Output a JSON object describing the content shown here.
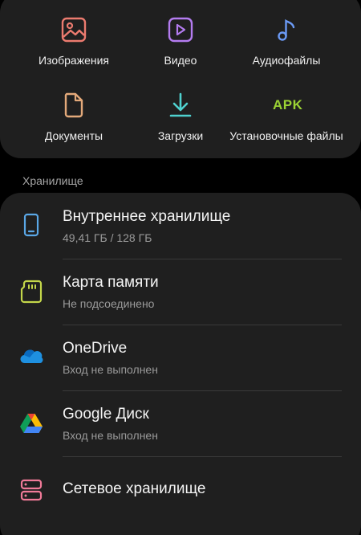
{
  "categories": [
    {
      "label": "Изображения",
      "icon": "image-icon",
      "color": "#ec7b6f"
    },
    {
      "label": "Видео",
      "icon": "video-icon",
      "color": "#b47cf0"
    },
    {
      "label": "Аудиофайлы",
      "icon": "music-note-icon",
      "color": "#6b9af5"
    },
    {
      "label": "Документы",
      "icon": "document-icon",
      "color": "#e3a97a"
    },
    {
      "label": "Загрузки",
      "icon": "download-icon",
      "color": "#4fd1cf"
    },
    {
      "label": "Установочные файлы",
      "icon": "apk-icon",
      "color": "#9bd234",
      "glyph": "APK"
    }
  ],
  "storage": {
    "section_title": "Хранилище",
    "items": [
      {
        "title": "Внутреннее хранилище",
        "subtitle": "49,41 ГБ / 128 ГБ",
        "icon": "phone-storage-icon",
        "color": "#5aa7e6"
      },
      {
        "title": "Карта памяти",
        "subtitle": "Не подсоединено",
        "icon": "sd-card-icon",
        "color": "#c3d64a"
      },
      {
        "title": "OneDrive",
        "subtitle": "Вход не выполнен",
        "icon": "onedrive-icon",
        "color": "#1e90e0"
      },
      {
        "title": "Google Диск",
        "subtitle": "Вход не выполнен",
        "icon": "google-drive-icon",
        "color": "#34a853"
      },
      {
        "title": "Сетевое хранилище",
        "subtitle": "",
        "icon": "network-storage-icon",
        "color": "#f07a98"
      }
    ]
  }
}
